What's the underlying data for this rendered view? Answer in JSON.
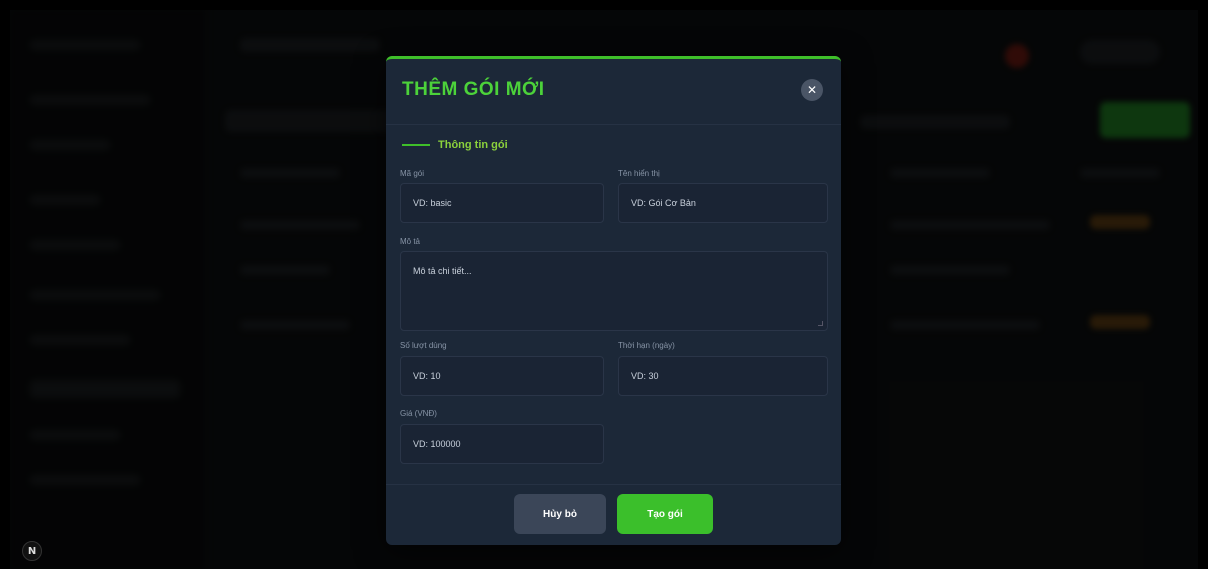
{
  "modal": {
    "title": "THÊM GÓI MỚI",
    "close_symbol": "✕",
    "section_title": "Thông tin gói",
    "fields": {
      "package_code": {
        "label": "Mã gói",
        "placeholder": "VD: basic"
      },
      "display_name": {
        "label": "Tên hiển thị",
        "placeholder": "VD: Gói Cơ Bản"
      },
      "description": {
        "label": "Mô tả",
        "placeholder": "Mô tả chi tiết..."
      },
      "request_count": {
        "label": "Số lượt dùng",
        "placeholder": "VD: 10"
      },
      "duration": {
        "label": "Thời hạn (ngày)",
        "placeholder": "VD: 30"
      },
      "price": {
        "label": "Giá (VNĐ)",
        "placeholder": "VD: 100000"
      }
    },
    "buttons": {
      "cancel": "Hủy bỏ",
      "create": "Tạo gói"
    }
  },
  "background": {
    "corner_badge": "N"
  },
  "colors": {
    "accent_green": "#3bbf2b",
    "title_green": "#4cd23a",
    "modal_bg": "#1c2838"
  }
}
